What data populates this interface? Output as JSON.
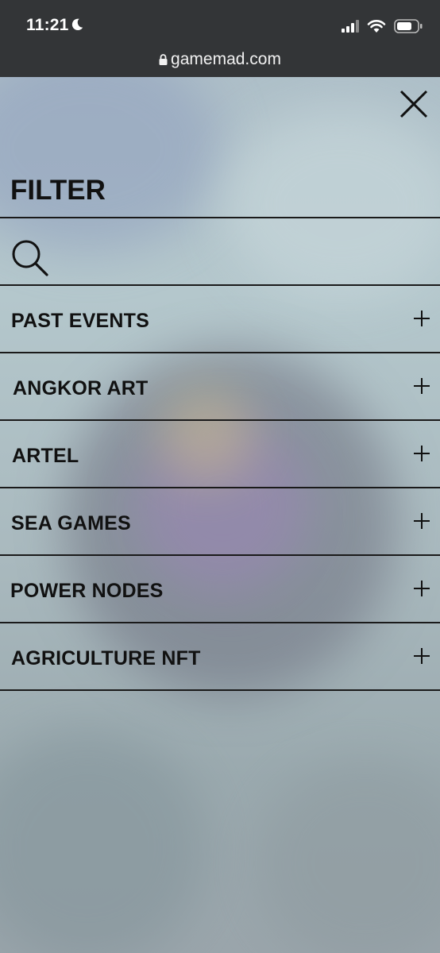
{
  "status_bar": {
    "time": "11:21",
    "url": "gamemad.com"
  },
  "panel": {
    "title": "FILTER",
    "close_icon": "close-icon",
    "search_icon": "search-icon"
  },
  "menu": {
    "items": [
      {
        "label": "PAST EVENTS"
      },
      {
        "label": "ANGKOR ART"
      },
      {
        "label": "ARTEL"
      },
      {
        "label": "SEA GAMES"
      },
      {
        "label": "POWER NODES"
      },
      {
        "label": "AGRICULTURE NFT"
      }
    ]
  }
}
